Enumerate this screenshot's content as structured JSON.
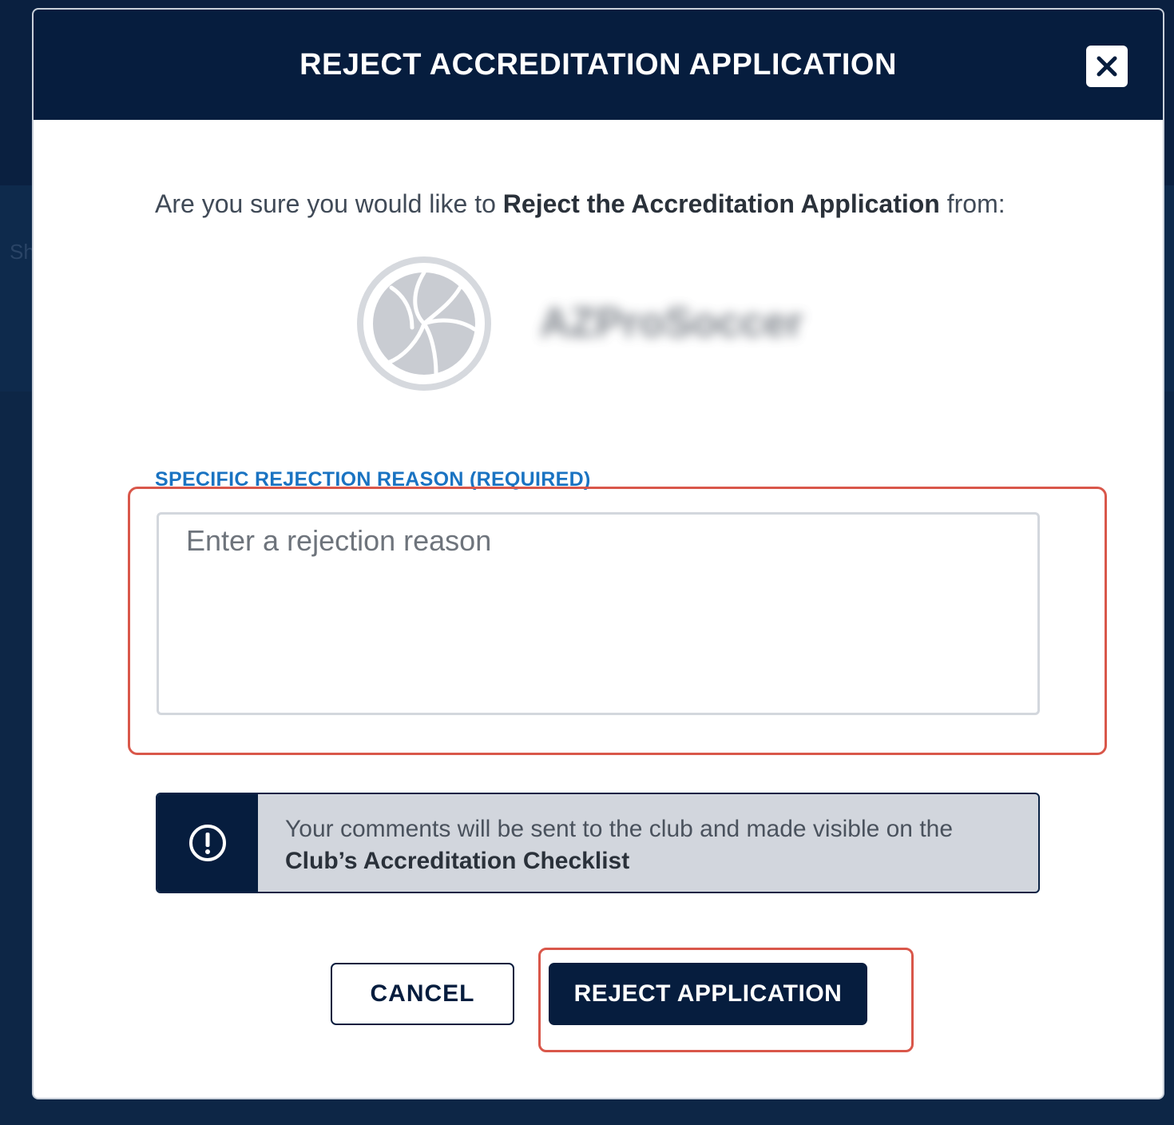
{
  "background": {
    "ghost_text": "Sh"
  },
  "modal": {
    "title": "REJECT ACCREDITATION APPLICATION",
    "close_icon": "close-icon",
    "prompt": {
      "prefix": "Are you sure you would like to ",
      "emphasis": "Reject the Accreditation Application",
      "suffix": " from:"
    },
    "club": {
      "logo_icon": "soccer-ball-icon",
      "name": "AZProSoccer"
    },
    "reason_field": {
      "label": "SPECIFIC REJECTION REASON (REQUIRED)",
      "placeholder": "Enter a rejection reason",
      "value": ""
    },
    "notice": {
      "icon": "exclamation-circle-icon",
      "text": "Your comments will be sent to the club and made visible on the",
      "emphasis": "Club’s Accreditation Checklist"
    },
    "actions": {
      "cancel_label": "CANCEL",
      "submit_label": "REJECT APPLICATION"
    }
  },
  "colors": {
    "navy": "#061d3e",
    "label_blue": "#1a73c2",
    "highlight_red": "#d9574a",
    "notice_gray": "#d2d6dd"
  }
}
